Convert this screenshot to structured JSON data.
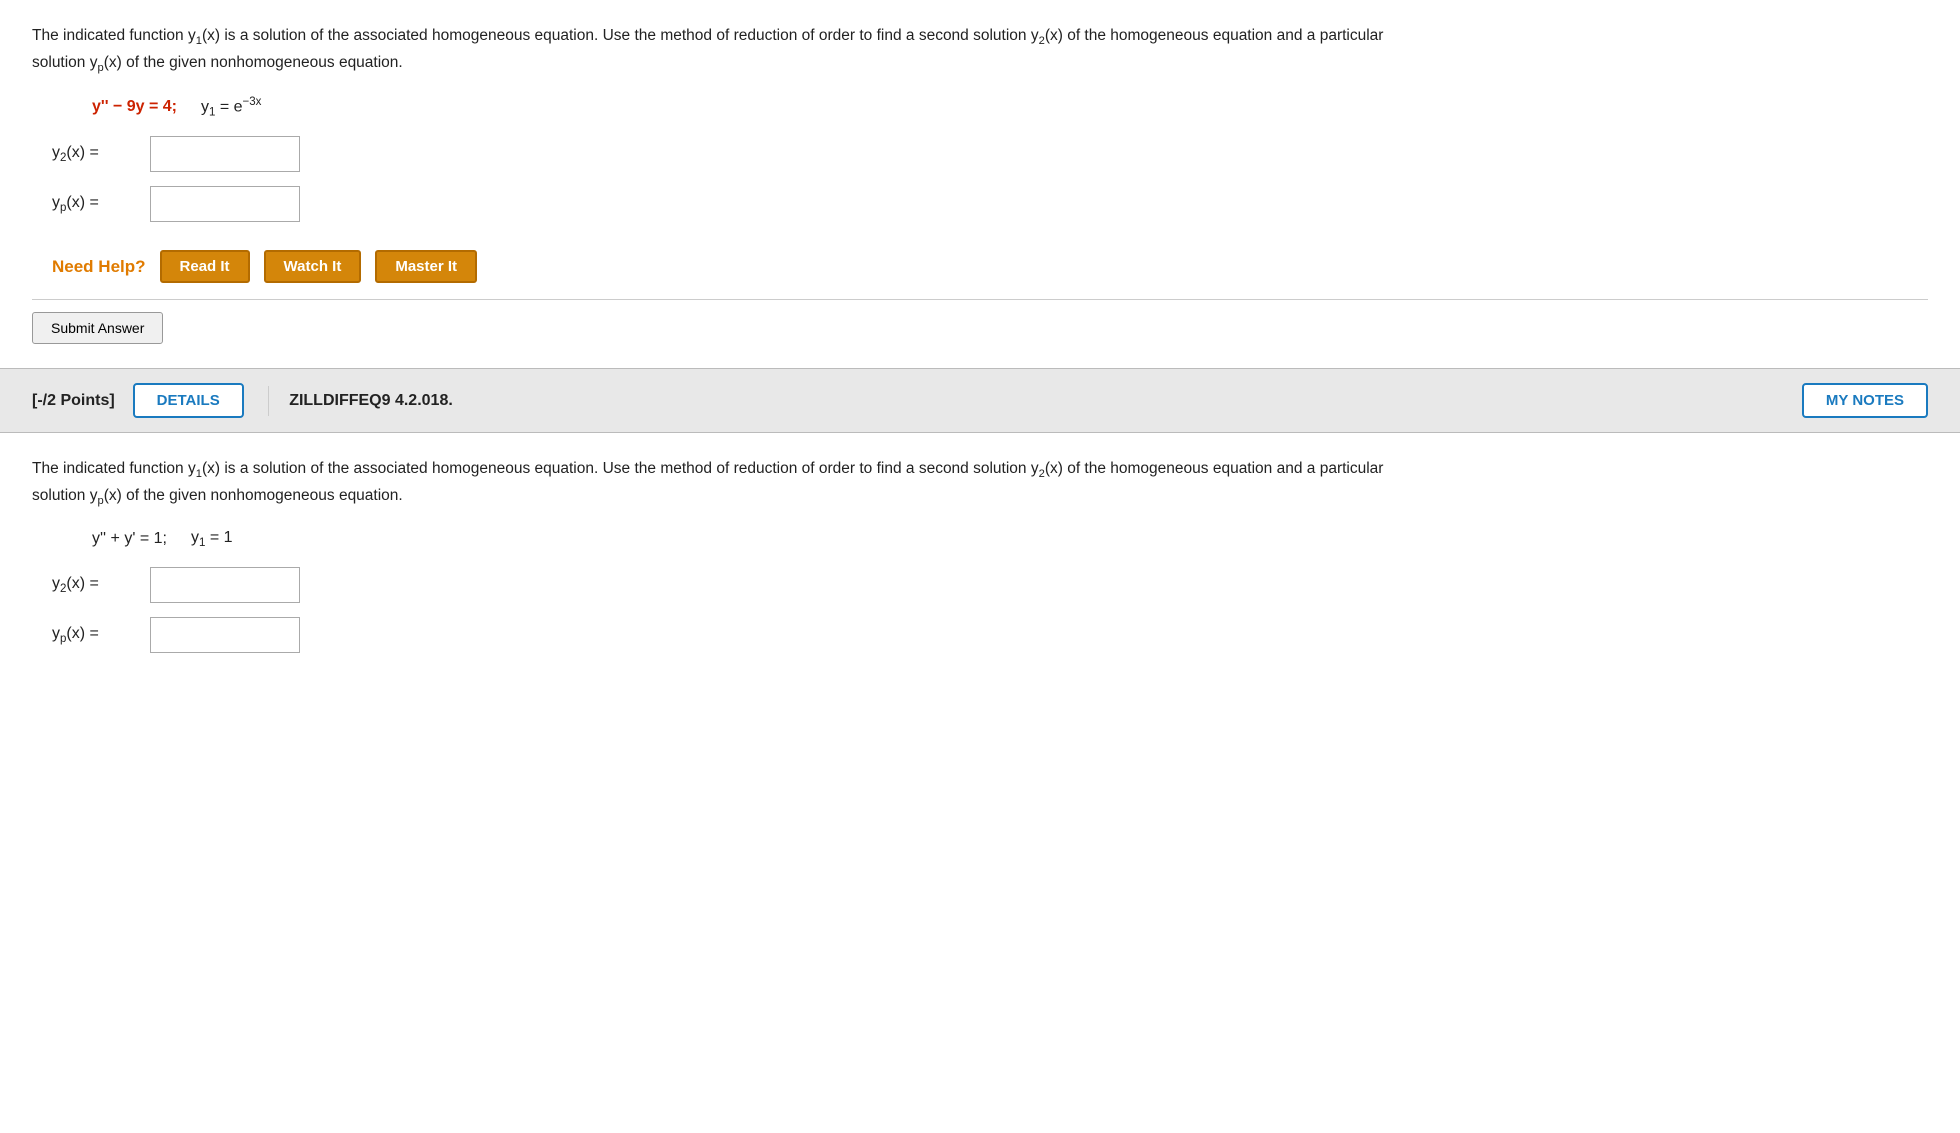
{
  "top": {
    "problem_text_1": "The indicated function y",
    "problem_text_1b": "1",
    "problem_text_1c": "(x) is a solution of the associated homogeneous equation. Use the method of reduction of order to find a second",
    "problem_text_2": "solution y",
    "problem_text_2b": "2",
    "problem_text_2c": "(x) of the homogeneous equation and a particular solution y",
    "problem_text_2d": "p",
    "problem_text_2e": "(x) of the given nonhomogeneous equation.",
    "equation": "y'' − 9y = 4;",
    "y1_label": "y",
    "y1_sub": "1",
    "y1_eq": " = e",
    "y1_exp": "−3x",
    "y2_label": "y₂(x) =",
    "yp_label": "yₚ(x) =",
    "need_help": "Need Help?",
    "read_it": "Read It",
    "watch_it": "Watch It",
    "master_it": "Master It",
    "submit": "Submit Answer"
  },
  "divider": {
    "points": "[-/2 Points]",
    "details": "DETAILS",
    "problem_id": "ZILLDIFFEQ9 4.2.018.",
    "my_notes": "MY NOTES"
  },
  "bottom": {
    "problem_text_1": "The indicated function y",
    "problem_text_1b": "1",
    "problem_text_1c": "(x) is a solution of the associated homogeneous equation. Use the method of reduction of order to find a second",
    "problem_text_2": "solution y",
    "problem_text_2b": "2",
    "problem_text_2c": "(x) of the homogeneous equation and a particular solution y",
    "problem_text_2d": "p",
    "problem_text_2e": "(x) of the given nonhomogeneous equation.",
    "equation": "y'' + y' = 1;",
    "y1_label": "y",
    "y1_sub": "1",
    "y1_eq": " = 1",
    "y2_label": "y₂(x) =",
    "yp_label": "yₚ(x) ="
  }
}
